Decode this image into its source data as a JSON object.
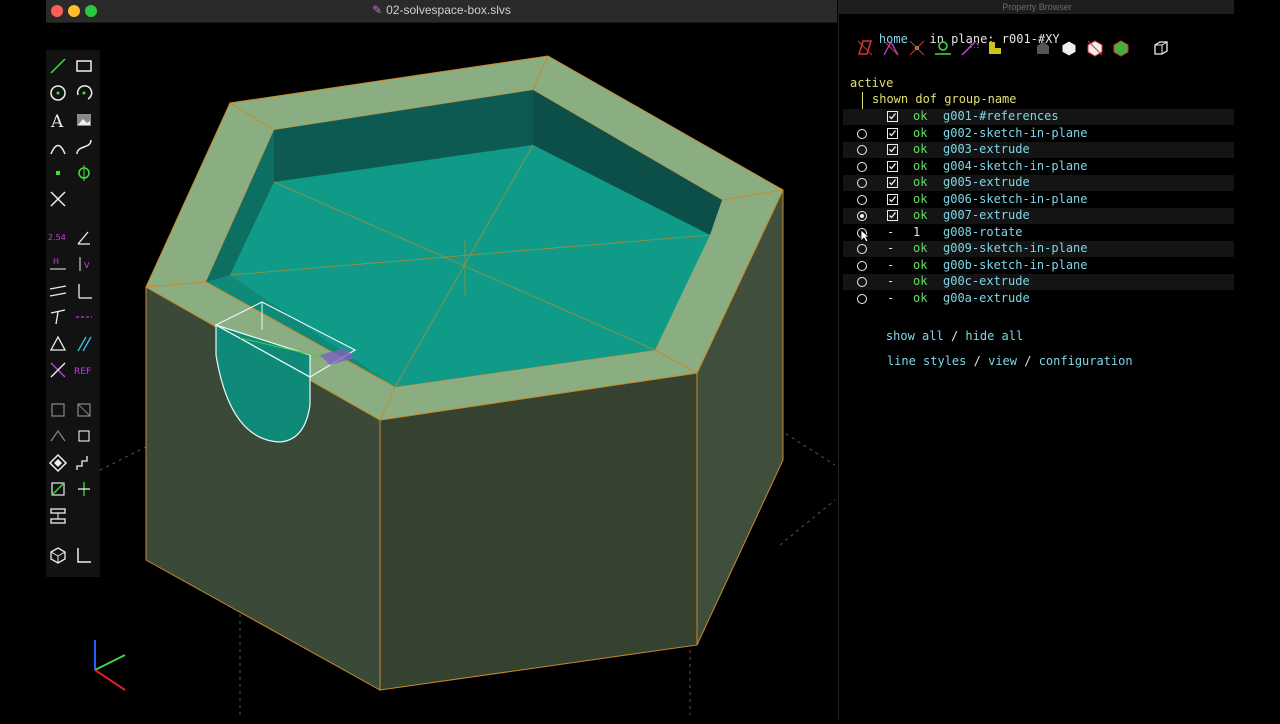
{
  "window": {
    "title": "02-solvespace-box.slvs",
    "traffic_colors": [
      "#ff5f57",
      "#febc2e",
      "#28c840"
    ]
  },
  "toolbar": {
    "ref_label": "REF",
    "dim_label": "2.54",
    "angle_label": "∠"
  },
  "property_browser": {
    "window_title": "Property Browser",
    "home_label": "home",
    "in_plane_label": "in plane:",
    "in_plane_value": "r001-#XY",
    "active_label": "active",
    "header": "shown dof group-name",
    "groups": [
      {
        "radio": false,
        "shown": true,
        "dof": "ok",
        "name": "g001-#references",
        "has_radio": false
      },
      {
        "radio": false,
        "shown": true,
        "dof": "ok",
        "name": "g002-sketch-in-plane",
        "has_radio": true
      },
      {
        "radio": false,
        "shown": true,
        "dof": "ok",
        "name": "g003-extrude",
        "has_radio": true
      },
      {
        "radio": false,
        "shown": true,
        "dof": "ok",
        "name": "g004-sketch-in-plane",
        "has_radio": true
      },
      {
        "radio": false,
        "shown": true,
        "dof": "ok",
        "name": "g005-extrude",
        "has_radio": true
      },
      {
        "radio": false,
        "shown": true,
        "dof": "ok",
        "name": "g006-sketch-in-plane",
        "has_radio": true
      },
      {
        "radio": true,
        "shown": true,
        "dof": "ok",
        "name": "g007-extrude",
        "has_radio": true
      },
      {
        "radio": false,
        "shown": false,
        "dof": "1",
        "name": "g008-rotate",
        "has_radio": true
      },
      {
        "radio": false,
        "shown": false,
        "dof": "ok",
        "name": "g009-sketch-in-plane",
        "has_radio": true
      },
      {
        "radio": false,
        "shown": false,
        "dof": "ok",
        "name": "g00b-sketch-in-plane",
        "has_radio": true
      },
      {
        "radio": false,
        "shown": false,
        "dof": "ok",
        "name": "g00c-extrude",
        "has_radio": true
      },
      {
        "radio": false,
        "shown": false,
        "dof": "ok",
        "name": "g00a-extrude",
        "has_radio": true
      }
    ],
    "dash": "-",
    "show_all": "show all",
    "hide_all": "hide all",
    "slash": "/",
    "line_styles": "line styles",
    "view": "view",
    "configuration": "configuration"
  },
  "colors": {
    "accent": "#7ed7e9",
    "ok_green": "#5fe05f",
    "model_side": "#3b4a38",
    "model_top": "#8aae82",
    "cavity": "#0f8a78",
    "edge": "#c88a2a"
  }
}
